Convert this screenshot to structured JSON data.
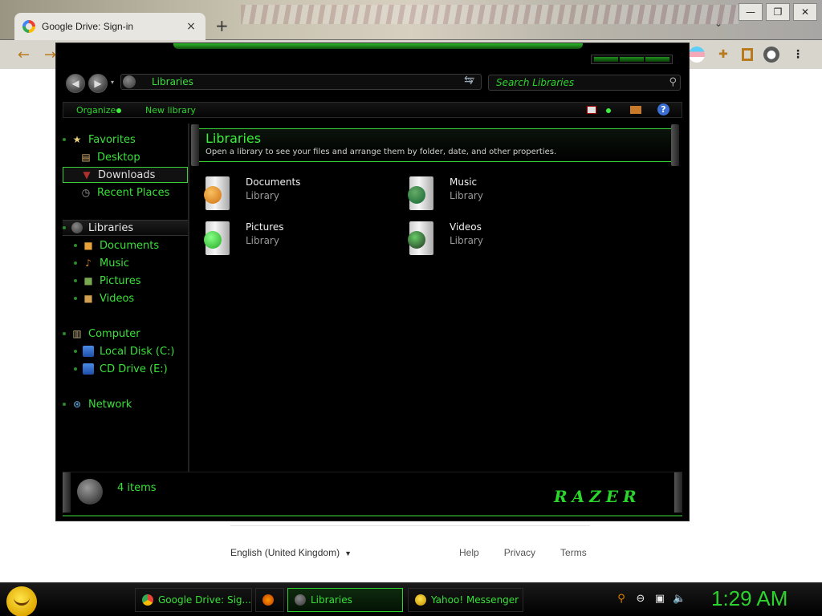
{
  "chrome": {
    "tab_title": "Google Drive: Sign-in",
    "tab_close": "×",
    "new_tab": "+",
    "win_controls": [
      "—",
      "❐",
      "✕"
    ],
    "tab_list_caret": "⌄",
    "back": "←",
    "forward": "→"
  },
  "page": {
    "language": "English (United Kingdom)",
    "language_caret": "▼",
    "links": [
      "Help",
      "Privacy",
      "Terms"
    ]
  },
  "explorer": {
    "address": "Libraries",
    "address_caret": "▽",
    "search_placeholder": "Search Libraries",
    "search_icon": "⚲",
    "refresh_icon": "⇆",
    "nav_back": "◀",
    "nav_forward": "▶",
    "nav_history_caret": "▾",
    "toolbar": {
      "organize": "Organize",
      "new_library": "New library",
      "help": "?"
    },
    "sidebar": {
      "favorites": "Favorites",
      "desktop": "Desktop",
      "downloads": "Downloads",
      "recent_places": "Recent Places",
      "libraries": "Libraries",
      "documents": "Documents",
      "music": "Music",
      "pictures": "Pictures",
      "videos": "Videos",
      "computer": "Computer",
      "local_disk": "Local Disk (C:)",
      "cd_drive": "CD Drive (E:)",
      "network": "Network",
      "icons": {
        "star": "★",
        "desktop": "▤",
        "downloads": "▼",
        "recent": "◷",
        "computer": "▥",
        "network": "⊛"
      }
    },
    "main": {
      "title": "Libraries",
      "subtitle": "Open a library to see your files and arrange them by folder, date, and other properties.",
      "tiles": [
        {
          "name": "Documents",
          "type": "Library"
        },
        {
          "name": "Music",
          "type": "Library"
        },
        {
          "name": "Pictures",
          "type": "Library"
        },
        {
          "name": "Videos",
          "type": "Library"
        }
      ]
    },
    "status": {
      "count": "4 items",
      "brand": "RAZER"
    }
  },
  "taskbar": {
    "buttons": [
      "Google Drive: Sig...",
      "Libraries",
      "Yahoo! Messenger"
    ],
    "tray": {
      "search": "⚲",
      "status": "⊖",
      "network": "▣",
      "volume": "🔈"
    },
    "clock": "1:29 AM"
  }
}
